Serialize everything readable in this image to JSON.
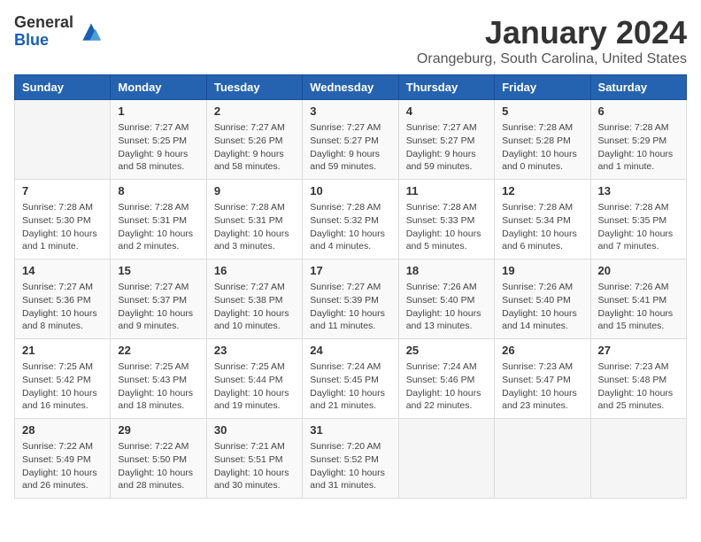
{
  "logo": {
    "general": "General",
    "blue": "Blue"
  },
  "title": "January 2024",
  "location": "Orangeburg, South Carolina, United States",
  "days_of_week": [
    "Sunday",
    "Monday",
    "Tuesday",
    "Wednesday",
    "Thursday",
    "Friday",
    "Saturday"
  ],
  "weeks": [
    [
      {
        "day": "",
        "content": ""
      },
      {
        "day": "1",
        "content": "Sunrise: 7:27 AM\nSunset: 5:25 PM\nDaylight: 9 hours\nand 58 minutes."
      },
      {
        "day": "2",
        "content": "Sunrise: 7:27 AM\nSunset: 5:26 PM\nDaylight: 9 hours\nand 58 minutes."
      },
      {
        "day": "3",
        "content": "Sunrise: 7:27 AM\nSunset: 5:27 PM\nDaylight: 9 hours\nand 59 minutes."
      },
      {
        "day": "4",
        "content": "Sunrise: 7:27 AM\nSunset: 5:27 PM\nDaylight: 9 hours\nand 59 minutes."
      },
      {
        "day": "5",
        "content": "Sunrise: 7:28 AM\nSunset: 5:28 PM\nDaylight: 10 hours\nand 0 minutes."
      },
      {
        "day": "6",
        "content": "Sunrise: 7:28 AM\nSunset: 5:29 PM\nDaylight: 10 hours\nand 1 minute."
      }
    ],
    [
      {
        "day": "7",
        "content": "Sunrise: 7:28 AM\nSunset: 5:30 PM\nDaylight: 10 hours\nand 1 minute."
      },
      {
        "day": "8",
        "content": "Sunrise: 7:28 AM\nSunset: 5:31 PM\nDaylight: 10 hours\nand 2 minutes."
      },
      {
        "day": "9",
        "content": "Sunrise: 7:28 AM\nSunset: 5:31 PM\nDaylight: 10 hours\nand 3 minutes."
      },
      {
        "day": "10",
        "content": "Sunrise: 7:28 AM\nSunset: 5:32 PM\nDaylight: 10 hours\nand 4 minutes."
      },
      {
        "day": "11",
        "content": "Sunrise: 7:28 AM\nSunset: 5:33 PM\nDaylight: 10 hours\nand 5 minutes."
      },
      {
        "day": "12",
        "content": "Sunrise: 7:28 AM\nSunset: 5:34 PM\nDaylight: 10 hours\nand 6 minutes."
      },
      {
        "day": "13",
        "content": "Sunrise: 7:28 AM\nSunset: 5:35 PM\nDaylight: 10 hours\nand 7 minutes."
      }
    ],
    [
      {
        "day": "14",
        "content": "Sunrise: 7:27 AM\nSunset: 5:36 PM\nDaylight: 10 hours\nand 8 minutes."
      },
      {
        "day": "15",
        "content": "Sunrise: 7:27 AM\nSunset: 5:37 PM\nDaylight: 10 hours\nand 9 minutes."
      },
      {
        "day": "16",
        "content": "Sunrise: 7:27 AM\nSunset: 5:38 PM\nDaylight: 10 hours\nand 10 minutes."
      },
      {
        "day": "17",
        "content": "Sunrise: 7:27 AM\nSunset: 5:39 PM\nDaylight: 10 hours\nand 11 minutes."
      },
      {
        "day": "18",
        "content": "Sunrise: 7:26 AM\nSunset: 5:40 PM\nDaylight: 10 hours\nand 13 minutes."
      },
      {
        "day": "19",
        "content": "Sunrise: 7:26 AM\nSunset: 5:40 PM\nDaylight: 10 hours\nand 14 minutes."
      },
      {
        "day": "20",
        "content": "Sunrise: 7:26 AM\nSunset: 5:41 PM\nDaylight: 10 hours\nand 15 minutes."
      }
    ],
    [
      {
        "day": "21",
        "content": "Sunrise: 7:25 AM\nSunset: 5:42 PM\nDaylight: 10 hours\nand 16 minutes."
      },
      {
        "day": "22",
        "content": "Sunrise: 7:25 AM\nSunset: 5:43 PM\nDaylight: 10 hours\nand 18 minutes."
      },
      {
        "day": "23",
        "content": "Sunrise: 7:25 AM\nSunset: 5:44 PM\nDaylight: 10 hours\nand 19 minutes."
      },
      {
        "day": "24",
        "content": "Sunrise: 7:24 AM\nSunset: 5:45 PM\nDaylight: 10 hours\nand 21 minutes."
      },
      {
        "day": "25",
        "content": "Sunrise: 7:24 AM\nSunset: 5:46 PM\nDaylight: 10 hours\nand 22 minutes."
      },
      {
        "day": "26",
        "content": "Sunrise: 7:23 AM\nSunset: 5:47 PM\nDaylight: 10 hours\nand 23 minutes."
      },
      {
        "day": "27",
        "content": "Sunrise: 7:23 AM\nSunset: 5:48 PM\nDaylight: 10 hours\nand 25 minutes."
      }
    ],
    [
      {
        "day": "28",
        "content": "Sunrise: 7:22 AM\nSunset: 5:49 PM\nDaylight: 10 hours\nand 26 minutes."
      },
      {
        "day": "29",
        "content": "Sunrise: 7:22 AM\nSunset: 5:50 PM\nDaylight: 10 hours\nand 28 minutes."
      },
      {
        "day": "30",
        "content": "Sunrise: 7:21 AM\nSunset: 5:51 PM\nDaylight: 10 hours\nand 30 minutes."
      },
      {
        "day": "31",
        "content": "Sunrise: 7:20 AM\nSunset: 5:52 PM\nDaylight: 10 hours\nand 31 minutes."
      },
      {
        "day": "",
        "content": ""
      },
      {
        "day": "",
        "content": ""
      },
      {
        "day": "",
        "content": ""
      }
    ]
  ]
}
